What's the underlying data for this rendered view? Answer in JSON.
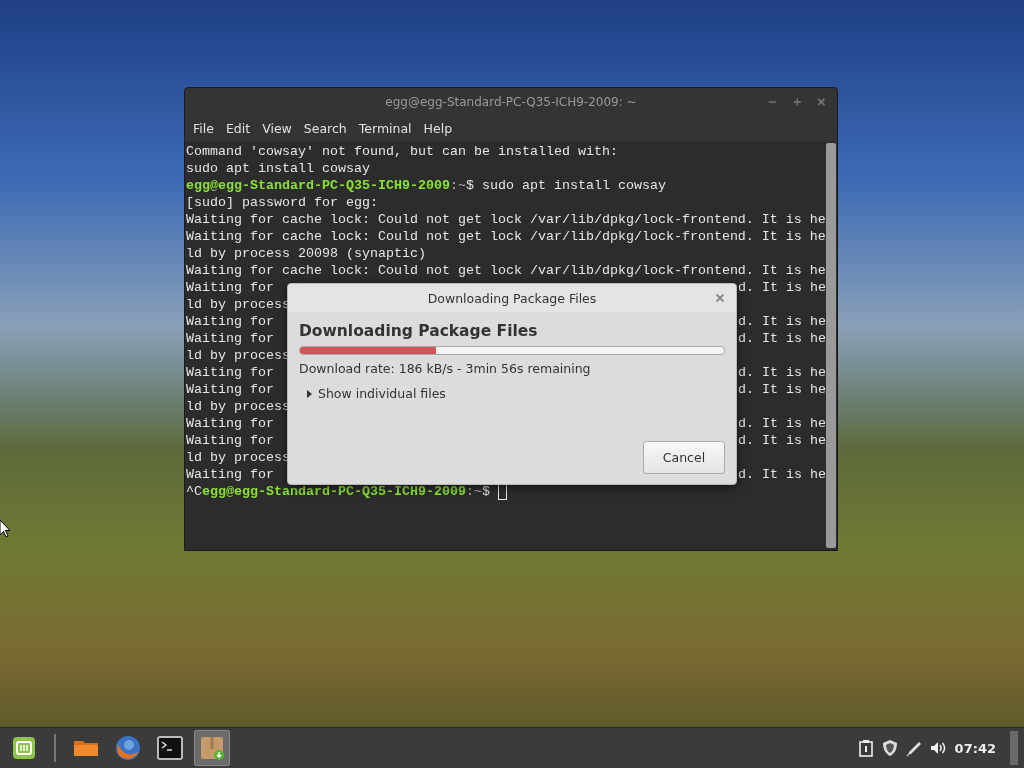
{
  "terminal": {
    "title": "egg@egg-Standard-PC-Q35-ICH9-2009: ~",
    "menu": [
      "File",
      "Edit",
      "View",
      "Search",
      "Terminal",
      "Help"
    ],
    "lines": [
      {
        "kind": "plain",
        "text": "Command 'cowsay' not found, but can be installed with:"
      },
      {
        "kind": "plain",
        "text": "sudo apt install cowsay"
      },
      {
        "kind": "prompt",
        "host": "egg@egg-Standard-PC-Q35-ICH9-2009",
        "path": ":~",
        "command": "$ sudo apt install cowsay"
      },
      {
        "kind": "plain",
        "text": "[sudo] password for egg:"
      },
      {
        "kind": "plain",
        "text": "Waiting for cache lock: Could not get lock /var/lib/dpkg/lock-frontend. It is he"
      },
      {
        "kind": "plain",
        "text": "Waiting for cache lock: Could not get lock /var/lib/dpkg/lock-frontend. It is he"
      },
      {
        "kind": "plain",
        "text": "ld by process 20098 (synaptic)"
      },
      {
        "kind": "plain",
        "text": "Waiting for cache lock: Could not get lock /var/lib/dpkg/lock-frontend. It is he"
      },
      {
        "kind": "covered",
        "left": "Waiting for",
        "right": "d. It is he"
      },
      {
        "kind": "covered",
        "left": "ld by process"
      },
      {
        "kind": "covered",
        "left": "Waiting for",
        "right": "d. It is he"
      },
      {
        "kind": "covered",
        "left": "Waiting for",
        "right": "d. It is he"
      },
      {
        "kind": "covered",
        "left": "ld by process"
      },
      {
        "kind": "covered",
        "left": "Waiting for",
        "right": "d. It is he"
      },
      {
        "kind": "covered",
        "left": "Waiting for",
        "right": "d. It is he"
      },
      {
        "kind": "covered",
        "left": "ld by process"
      },
      {
        "kind": "covered",
        "left": "Waiting for",
        "right": "d. It is he"
      },
      {
        "kind": "covered",
        "left": "Waiting for",
        "right": "d. It is he"
      },
      {
        "kind": "covered",
        "left": "ld by process"
      },
      {
        "kind": "covered",
        "left": "Waiting for",
        "right": "d. It is he"
      },
      {
        "kind": "prompt",
        "prefix": "^C",
        "host": "egg@egg-Standard-PC-Q35-ICH9-2009",
        "path": ":~",
        "command": "$ ",
        "cursor": true
      }
    ]
  },
  "dialog": {
    "title": "Downloading Package Files",
    "heading": "Downloading Package Files",
    "progress": {
      "level": 0.32
    },
    "status": "Download rate: 186 kB/s - 3min 56s remaining",
    "expander": {
      "label": "Show individual files",
      "expanded": false
    },
    "buttons": [
      "Cancel"
    ]
  },
  "taskbar": {
    "launchers": [
      {
        "kind": "menu",
        "selected": false
      },
      {
        "kind": "separator"
      },
      {
        "kind": "files",
        "selected": false
      },
      {
        "kind": "browser",
        "selected": false
      },
      {
        "kind": "terminal",
        "selected": false
      },
      {
        "kind": "package",
        "selected": true
      }
    ],
    "tray": [
      {
        "kind": "clipboard"
      },
      {
        "kind": "shield"
      },
      {
        "kind": "pen"
      },
      {
        "kind": "volume"
      }
    ],
    "clock": "07:42"
  }
}
